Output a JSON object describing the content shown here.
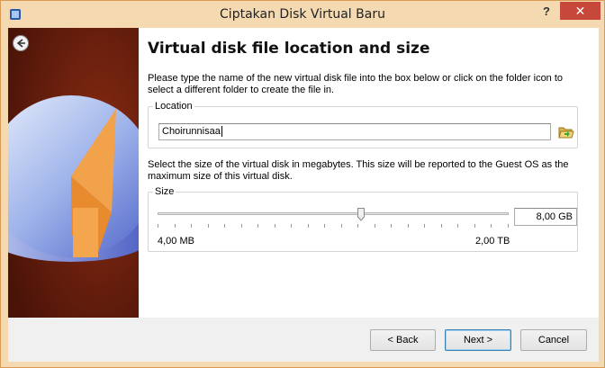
{
  "window": {
    "title": "Ciptakan Disk Virtual Baru",
    "help_label": "?",
    "close_label": "✕"
  },
  "page": {
    "title": "Virtual disk file location and size",
    "location_description": "Please type the name of the new virtual disk file into the box below or click on the folder icon to select a different folder to create the file in.",
    "location_group_label": "Location",
    "location_value": "Choirunnisaa",
    "size_description": "Select the size of the virtual disk in megabytes. This size will be reported to the Guest OS as the maximum size of this virtual disk.",
    "size_group_label": "Size",
    "size_value": "8,00 GB",
    "slider_min_label": "4,00 MB",
    "slider_max_label": "2,00 TB",
    "slider_position_fraction": 0.58
  },
  "buttons": {
    "back_label": "< Back",
    "next_label": "Next >",
    "cancel_label": "Cancel"
  },
  "icons": {
    "app": "virtualbox-icon",
    "back": "back-arrow-icon",
    "folder": "folder-open-icon"
  },
  "colors": {
    "sidebar": "#5c1a0c",
    "frame": "#f5d9b0",
    "close": "#c7483b"
  }
}
